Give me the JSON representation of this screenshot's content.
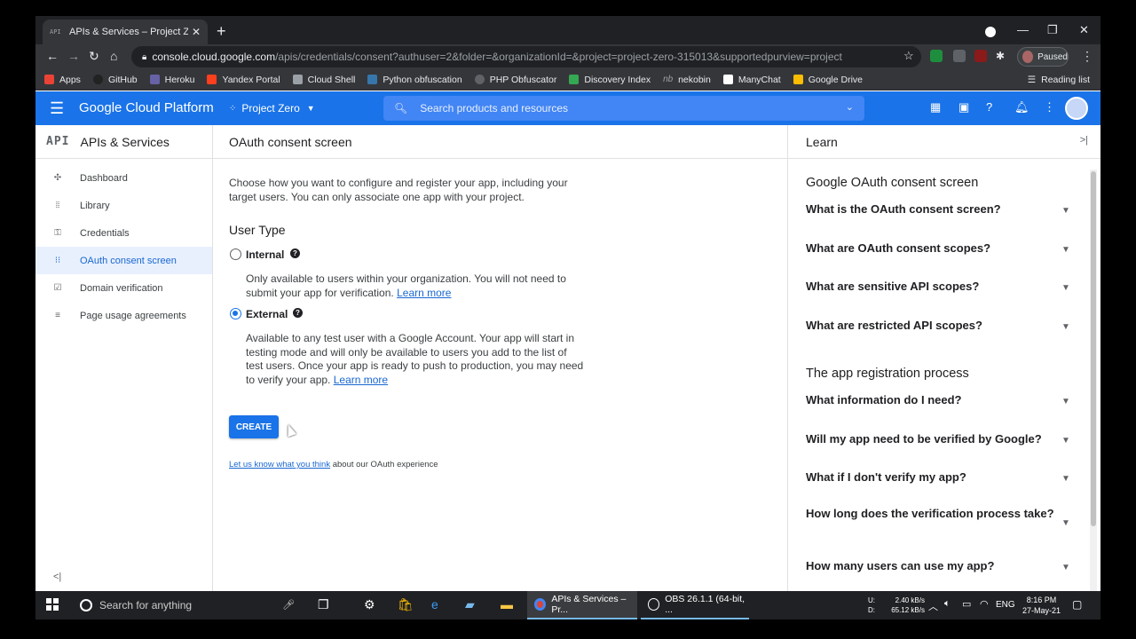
{
  "browser": {
    "tab_title": "APIs & Services – Project Zero – ",
    "tab_favicon": "API",
    "url_host": "console.cloud.google.com",
    "url_path": "/apis/credentials/consent?authuser=2&folder=&organizationId=&project=project-zero-315013&supportedpurview=project",
    "profile_status": "Paused"
  },
  "bookmarks": [
    "Apps",
    "GitHub",
    "Heroku",
    "Yandex Portal",
    "Cloud Shell",
    "Python obfuscation",
    "PHP Obfuscator",
    "Discovery Index",
    "nekobin",
    "ManyChat",
    "Google Drive"
  ],
  "reading_list": "Reading list",
  "header": {
    "title": "Google Cloud Platform",
    "project": "Project Zero",
    "search_placeholder": "Search products and resources"
  },
  "sidebar": {
    "badge": "API",
    "title": "APIs & Services",
    "items": [
      {
        "label": "Dashboard",
        "icon": "dashboard-icon"
      },
      {
        "label": "Library",
        "icon": "library-icon"
      },
      {
        "label": "Credentials",
        "icon": "key-icon"
      },
      {
        "label": "OAuth consent screen",
        "icon": "consent-icon"
      },
      {
        "label": "Domain verification",
        "icon": "verify-icon"
      },
      {
        "label": "Page usage agreements",
        "icon": "settings-list-icon"
      }
    ],
    "active_index": 3
  },
  "main": {
    "title": "OAuth consent screen",
    "intro": "Choose how you want to configure and register your app, including your target users. You can only associate one app with your project.",
    "user_type_title": "User Type",
    "internal": {
      "label": "Internal",
      "desc": "Only available to users within your organization. You will not need to submit your app for verification.",
      "link": "Learn more",
      "selected": false
    },
    "external": {
      "label": "External",
      "desc": "Available to any test user with a Google Account. Your app will start in testing mode and will only be available to users you add to the list of test users. Once your app is ready to push to production, you may need to verify your app.",
      "link": "Learn more",
      "selected": true
    },
    "create_label": "CREATE",
    "feedback_link": "Let us know what you think",
    "feedback_text": " about our OAuth experience"
  },
  "learn": {
    "title": "Learn",
    "section1": "Google OAuth consent screen",
    "section1_items": [
      "What is the OAuth consent screen?",
      "What are OAuth consent scopes?",
      "What are sensitive API scopes?",
      "What are restricted API scopes?"
    ],
    "section2": "The app registration process",
    "section2_items": [
      "What information do I need?",
      "Will my app need to be verified by Google?",
      "What if I don't verify my app?",
      "How long does the verification process take?",
      "How many users can use my app?"
    ]
  },
  "taskbar": {
    "search_placeholder": "Search for anything",
    "apps": [
      "APIs & Services – Pr...",
      "OBS 26.1.1 (64-bit, ..."
    ],
    "net_up": "2.40 kB/s",
    "net_down": "65.12 kB/s",
    "net_up_label": "U:",
    "net_down_label": "D:",
    "language": "ENG",
    "time": "8:16 PM",
    "date": "27-May-21"
  },
  "colors": {
    "gcp_blue": "#1a73e8",
    "chrome_dark": "#35363a",
    "link": "#1967d2"
  }
}
